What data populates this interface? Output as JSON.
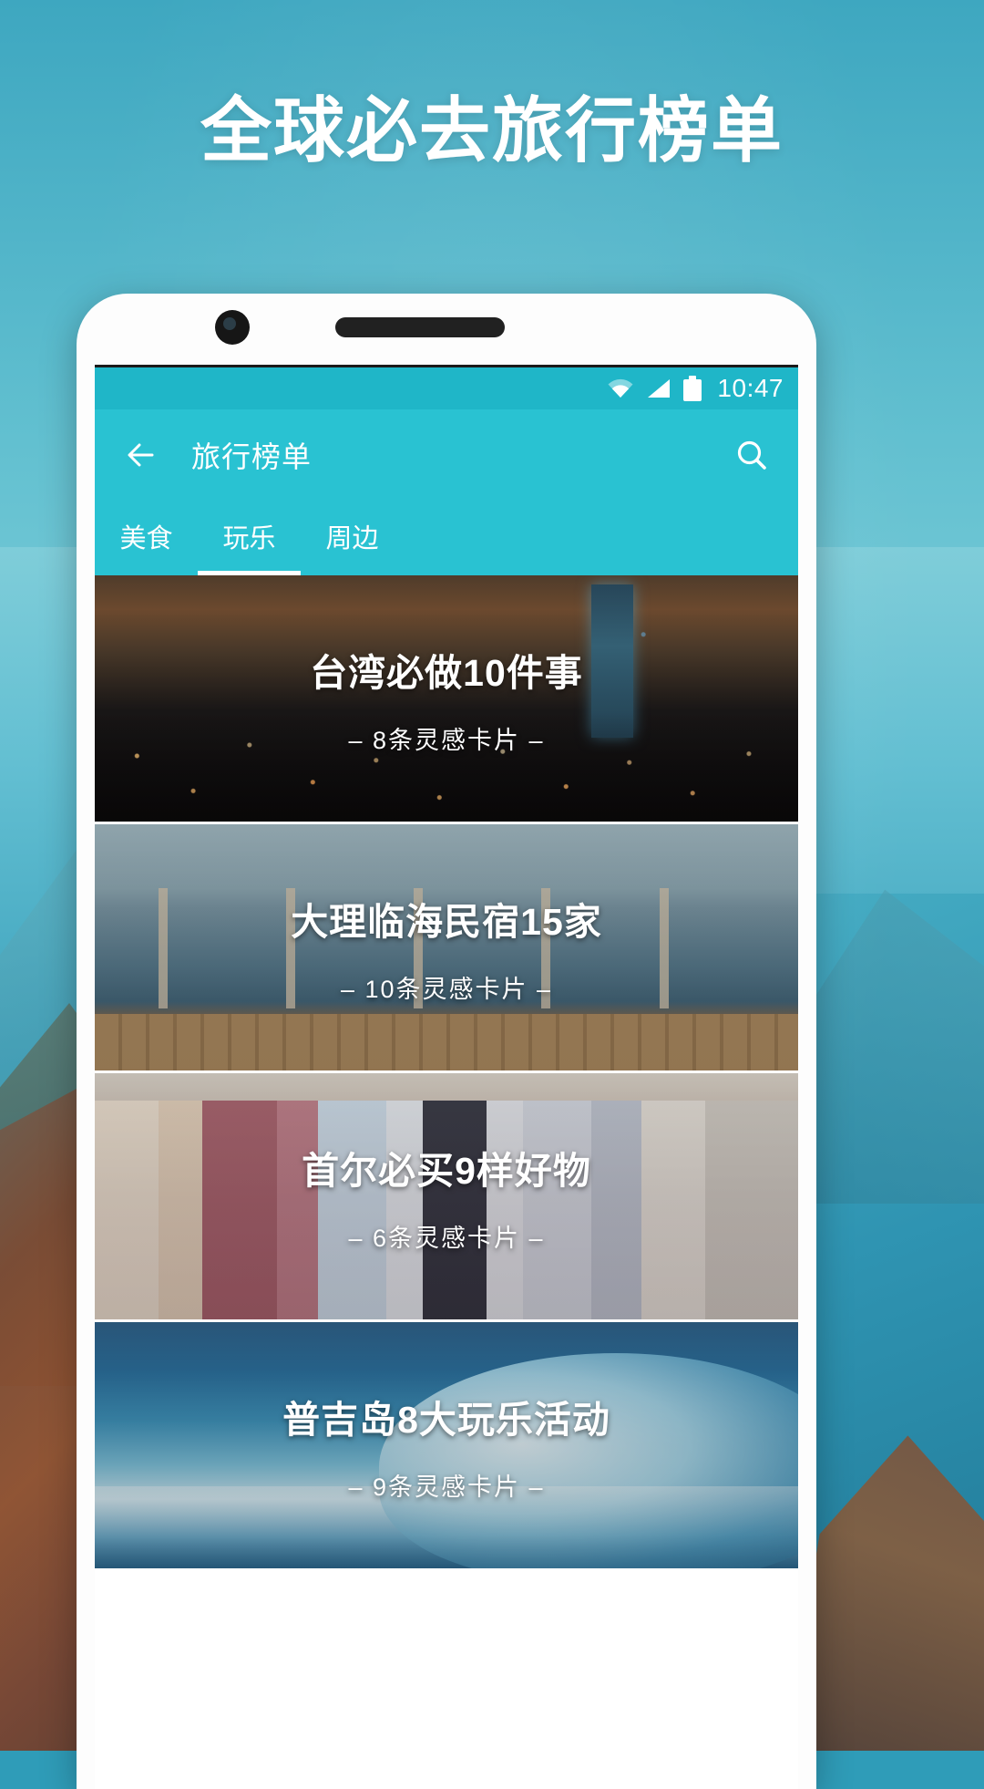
{
  "promo": {
    "headline": "全球必去旅行榜单"
  },
  "statusbar": {
    "time": "10:47",
    "icons": [
      "wifi-icon",
      "signal-icon",
      "battery-icon"
    ]
  },
  "appbar": {
    "back_icon": "back-arrow-icon",
    "title": "旅行榜单",
    "search_icon": "search-icon"
  },
  "tabs": {
    "items": [
      {
        "label": "美食",
        "active": false
      },
      {
        "label": "玩乐",
        "active": true
      },
      {
        "label": "周边",
        "active": false
      }
    ]
  },
  "list": {
    "cards": [
      {
        "title": "台湾必做10件事",
        "subtitle": "– 8条灵感卡片 –",
        "photo": "taipei-skyline"
      },
      {
        "title": "大理临海民宿15家",
        "subtitle": "– 10条灵感卡片 –",
        "photo": "dali-seaside-deck"
      },
      {
        "title": "首尔必买9样好物",
        "subtitle": "– 6条灵感卡片 –",
        "photo": "seoul-clothing-shop"
      },
      {
        "title": "普吉岛8大玩乐活动",
        "subtitle": "– 9条灵感卡片 –",
        "photo": "phuket-surfing"
      }
    ]
  },
  "colors": {
    "accent": "#29c2d2",
    "statusbar": "#1fb6c8",
    "promo_bg": "#3ea7c0"
  }
}
